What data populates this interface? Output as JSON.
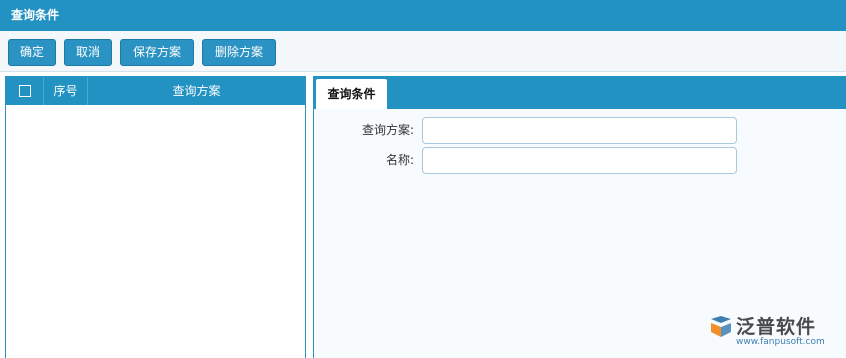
{
  "window": {
    "title": "查询条件"
  },
  "toolbar": {
    "confirm_label": "确定",
    "cancel_label": "取消",
    "save_scheme_label": "保存方案",
    "delete_scheme_label": "删除方案"
  },
  "grid": {
    "columns": [
      "序号",
      "查询方案"
    ],
    "rows": []
  },
  "tabs": [
    {
      "label": "查询条件",
      "active": true
    }
  ],
  "form": {
    "fields": [
      {
        "label": "查询方案:",
        "value": ""
      },
      {
        "label": "名称:",
        "value": ""
      }
    ]
  },
  "logo": {
    "name": "泛普软件",
    "url": "www.fanpusoft.com"
  },
  "colors": {
    "primary": "#2192c2",
    "button": "#2b93c4",
    "logo_orange": "#f0902a"
  }
}
